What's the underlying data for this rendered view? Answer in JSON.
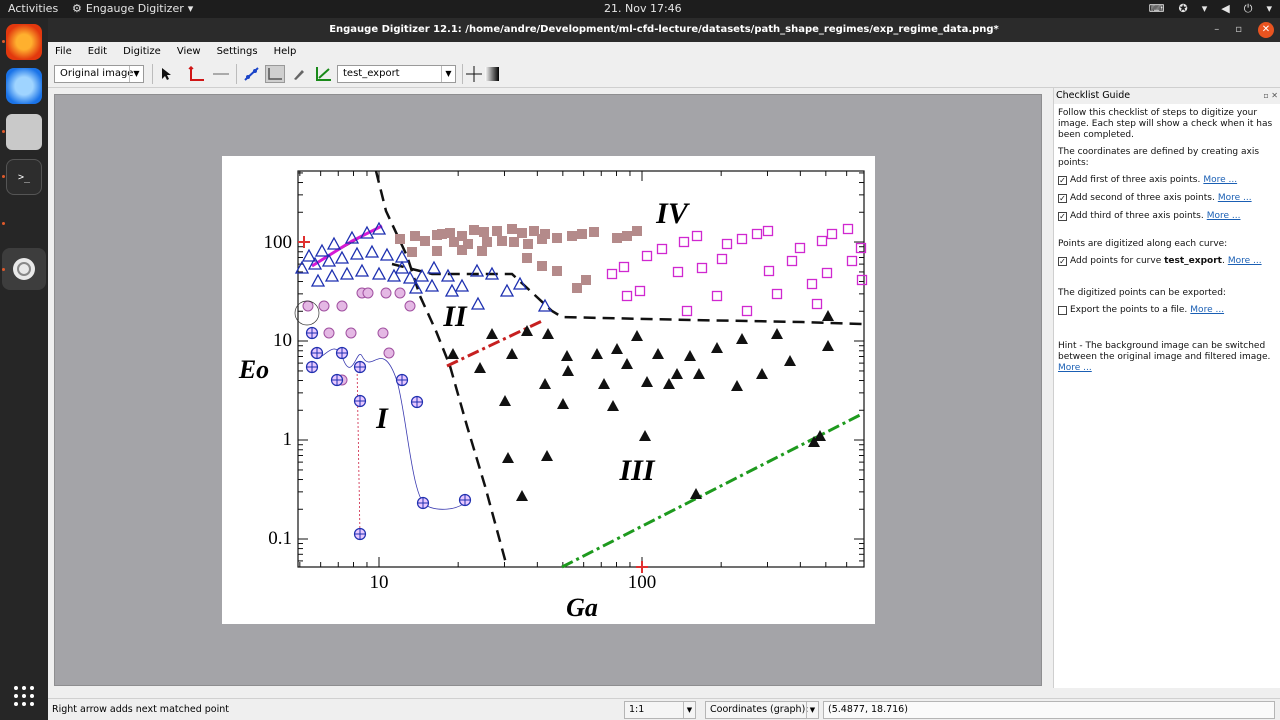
{
  "system_bar": {
    "activities": "Activities",
    "app_menu": "Engauge Digitizer",
    "clock": "21. Nov  17:46"
  },
  "window": {
    "title": "Engauge Digitizer 12.1: /home/andre/Development/ml-cfd-lecture/datasets/path_shape_regimes/exp_regime_data.png*"
  },
  "menu": [
    "File",
    "Edit",
    "Digitize",
    "View",
    "Settings",
    "Help"
  ],
  "toolbar": {
    "background_select": "Original image",
    "curve_select": "test_export"
  },
  "plot": {
    "ylabel": "Eo",
    "xlabel": "Ga",
    "yticks": [
      "100",
      "10",
      "1",
      "0.1"
    ],
    "xticks": [
      "10",
      "100"
    ],
    "regions": [
      "I",
      "II",
      "III",
      "IV"
    ]
  },
  "checklist": {
    "title": "Checklist Guide",
    "intro": "Follow this checklist of steps to digitize your image. Each step will show a check when it has been completed.",
    "axis_intro": "The coordinates are defined by creating axis points:",
    "axis_steps": [
      {
        "label": "Add first of three axis points.",
        "link": "More ...",
        "checked": true
      },
      {
        "label": "Add second of three axis points.",
        "link": "More ...",
        "checked": true
      },
      {
        "label": "Add third of three axis points.",
        "link": "More ...",
        "checked": true
      }
    ],
    "curve_intro": "Points are digitized along each curve:",
    "curve_step_prefix": "Add points for curve ",
    "curve_step_name": "test_export",
    "curve_step_suffix": ".",
    "curve_step_link": "More ...",
    "export_intro": "The digitized points can be exported:",
    "export_step": "Export the points to a file.",
    "export_link": "More ...",
    "hint": "Hint - The background image can be switched between the original image and filtered image.",
    "hint_link": "More ..."
  },
  "status": {
    "message": "Right arrow adds next matched point",
    "zoom": "1:1",
    "coord_mode": "Coordinates (graph):",
    "coords": "(5.4877, 18.716)"
  }
}
